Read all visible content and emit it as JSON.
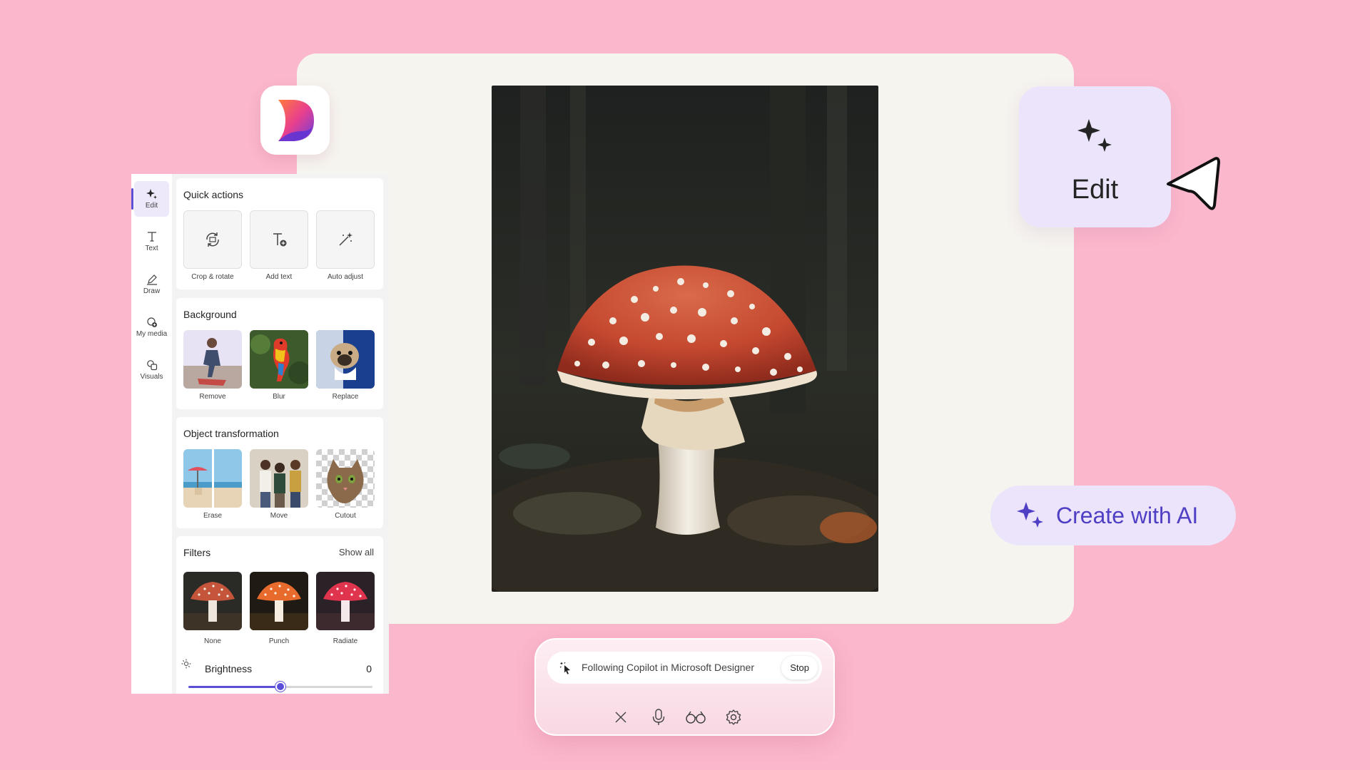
{
  "app": {
    "name": "Microsoft Designer",
    "logo_icon": "designer-logo-icon"
  },
  "rail": {
    "items": [
      {
        "label": "Edit",
        "icon": "sparkle-icon",
        "active": true
      },
      {
        "label": "Text",
        "icon": "text-icon"
      },
      {
        "label": "Draw",
        "icon": "pen-icon"
      },
      {
        "label": "My media",
        "icon": "media-add-icon"
      },
      {
        "label": "Visuals",
        "icon": "shapes-icon"
      }
    ]
  },
  "quick_actions": {
    "title": "Quick actions",
    "items": [
      {
        "label": "Crop & rotate",
        "icon": "crop-rotate-icon"
      },
      {
        "label": "Add text",
        "icon": "add-text-icon"
      },
      {
        "label": "Auto adjust",
        "icon": "magic-wand-icon"
      }
    ]
  },
  "background": {
    "title": "Background",
    "items": [
      {
        "label": "Remove"
      },
      {
        "label": "Blur"
      },
      {
        "label": "Replace"
      }
    ]
  },
  "object_transformation": {
    "title": "Object transformation",
    "items": [
      {
        "label": "Erase"
      },
      {
        "label": "Move"
      },
      {
        "label": "Cutout"
      }
    ]
  },
  "filters": {
    "title": "Filters",
    "show_all": "Show all",
    "items": [
      {
        "label": "None"
      },
      {
        "label": "Punch"
      },
      {
        "label": "Radiate"
      }
    ]
  },
  "brightness": {
    "label": "Brightness",
    "value": "0",
    "slider_fraction": 0.5
  },
  "edit_card": {
    "label": "Edit",
    "icon": "sparkles-icon"
  },
  "create_ai": {
    "label": "Create with AI",
    "icon": "sparkles-icon"
  },
  "copilot": {
    "status": "Following Copilot in Microsoft Designer",
    "stop_label": "Stop",
    "actions": [
      "close-icon",
      "microphone-icon",
      "glasses-icon",
      "settings-icon"
    ]
  },
  "colors": {
    "background": "#fbb7cb",
    "accent": "#5b4fd8",
    "card": "#ece4fb"
  }
}
